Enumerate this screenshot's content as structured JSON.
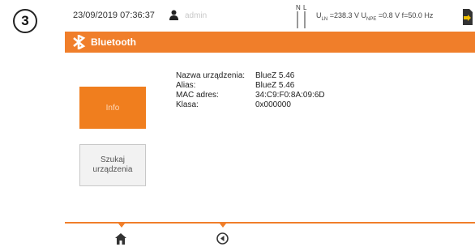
{
  "step_number": "3",
  "status_bar": {
    "datetime": "23/09/2019 07:36:37",
    "user": "admin",
    "nl_label_n": "N",
    "nl_label_l": "L",
    "measurement": "U",
    "u_ln_sub": "LN",
    "u_ln_value": "=238.3 V",
    "u_npe_sub": "NPE",
    "u_npe_value": "=0.8 V",
    "freq": "f=50.0 Hz"
  },
  "title_bar": {
    "title": "Bluetooth",
    "icon": "bluetooth-icon"
  },
  "left_buttons": {
    "info_label": "Info",
    "search_label_1": "Szukaj",
    "search_label_2": "urządzenia"
  },
  "info": [
    {
      "key": "Nazwa urządzenia:",
      "value": "BlueZ 5.46"
    },
    {
      "key": "Alias:",
      "value": "BlueZ 5.46"
    },
    {
      "key": "MAC adres:",
      "value": "34:C9:F0:8A:09:6D"
    },
    {
      "key": "Klasa:",
      "value": "0x000000"
    }
  ],
  "bottom_bar": {
    "home_icon": "home-icon",
    "back_icon": "back-icon"
  },
  "colors": {
    "accent": "#f07e2a",
    "button_active": "#f07e1e",
    "button_inactive": "#f2f2f2"
  }
}
